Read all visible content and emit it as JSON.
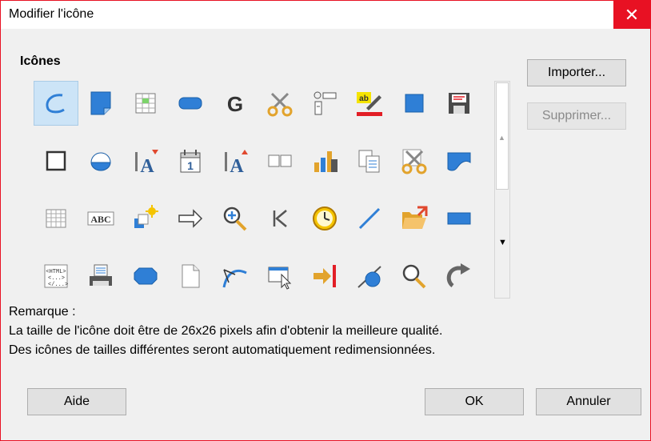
{
  "window": {
    "title": "Modifier l'icône",
    "close_glyph": "✕"
  },
  "icons_section": {
    "label": "Icônes",
    "rows": [
      [
        "ellipse-arc-icon",
        "page-corner-icon",
        "spreadsheet-table-icon",
        "rounded-rect-icon",
        "bold-g-icon",
        "scissors-icon",
        "form-controls-icon",
        "highlighter-icon",
        "blue-square-icon",
        "floppy-save-icon"
      ],
      [
        "square-outline-icon",
        "circle-segment-icon",
        "fontwork-a-down-icon",
        "calendar-icon",
        "fontwork-a-up-icon",
        "two-pages-icon",
        "bar-chart-icon",
        "copy-document-icon",
        "cut-scissors-icon",
        "wave-shape-icon"
      ],
      [
        "table-grid-icon",
        "abc-spellcheck-icon",
        "sparkle-stack-icon",
        "right-arrow-icon",
        "zoom-in-icon",
        "first-record-icon",
        "clock-icon",
        "diagonal-line-icon",
        "open-folder-icon",
        "blue-rectangle-icon"
      ],
      [
        "html-source-icon",
        "printer-icon",
        "blue-octagon-icon",
        "blank-page-icon",
        "bezier-curve-icon",
        "window-cursor-icon",
        "arrow-to-bar-icon",
        "circle-line-icon",
        "magnifier-icon",
        "redo-curved-icon"
      ]
    ],
    "selected_index": 0
  },
  "abc_text": "ABC",
  "html_text": "<HTML>",
  "calendar_day": "1",
  "buttons": {
    "import": "Importer...",
    "delete": "Supprimer...",
    "help": "Aide",
    "ok": "OK",
    "cancel": "Annuler"
  },
  "remark": {
    "heading": "Remarque :",
    "line1": "La taille de l'icône doit être de 26x26 pixels afin d'obtenir la meilleure qualité.",
    "line2": "Des icônes de tailles différentes seront automatiquement redimensionnées."
  },
  "colors": {
    "close_red": "#e81123",
    "selection": "#cce4f7",
    "icon_blue": "#2f7fd6",
    "icon_orange": "#e2a32c",
    "highlight_yellow": "#f5e400",
    "highlight_red": "#e21e26"
  }
}
